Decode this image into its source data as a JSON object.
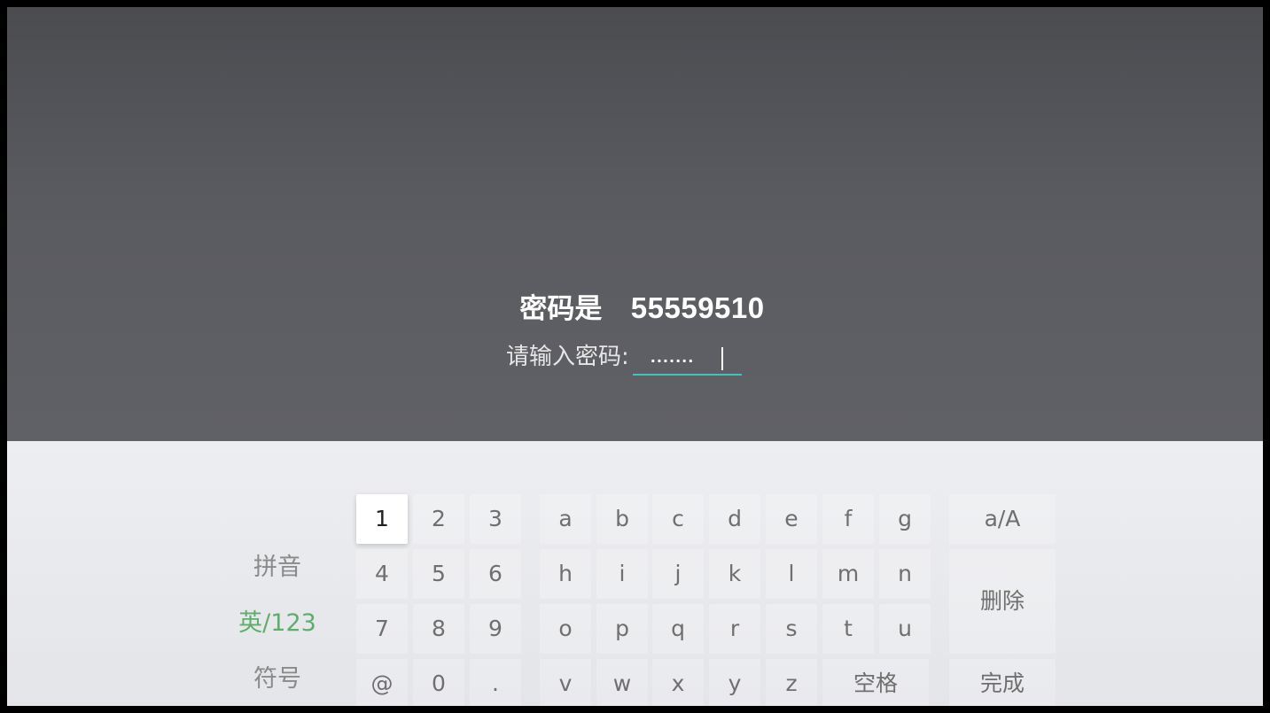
{
  "hint": {
    "label": "密码是",
    "code": "55559510"
  },
  "password": {
    "label": "请输入密码:",
    "masked_value": "·······"
  },
  "keyboard": {
    "modes": {
      "pinyin": "拼音",
      "english_123": "英/123",
      "symbols": "符号"
    },
    "rows": [
      [
        "1",
        "2",
        "3",
        "a",
        "b",
        "c",
        "d",
        "e",
        "f",
        "g"
      ],
      [
        "4",
        "5",
        "6",
        "h",
        "i",
        "j",
        "k",
        "l",
        "m",
        "n"
      ],
      [
        "7",
        "8",
        "9",
        "o",
        "p",
        "q",
        "r",
        "s",
        "t",
        "u"
      ],
      [
        "@",
        "0",
        ".",
        "v",
        "w",
        "x",
        "y",
        "z",
        "空格"
      ]
    ],
    "functions": {
      "case_toggle": "a/A",
      "delete": "删除",
      "done": "完成"
    }
  },
  "colors": {
    "accent_underline": "#40c4b8",
    "active_mode": "#5eae6b"
  }
}
